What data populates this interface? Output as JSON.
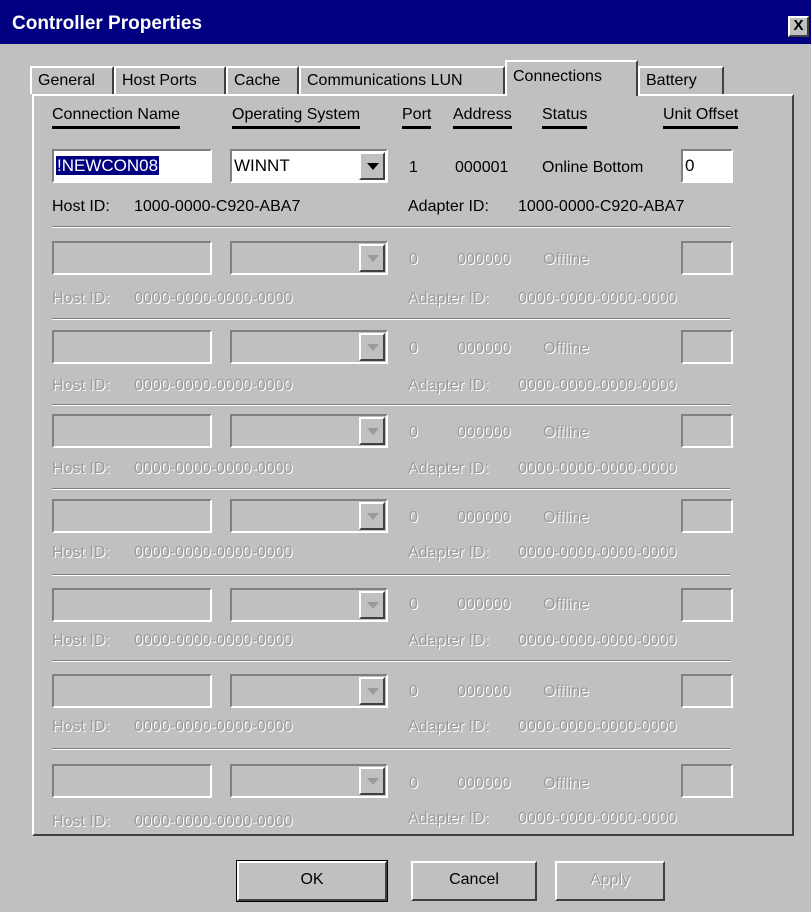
{
  "window": {
    "title": "Controller Properties",
    "close_label": "X"
  },
  "tabs": [
    {
      "label": "General"
    },
    {
      "label": "Host Ports"
    },
    {
      "label": "Cache"
    },
    {
      "label": "Communications LUN"
    },
    {
      "label": "Connections"
    },
    {
      "label": "Battery"
    }
  ],
  "active_tab": "Connections",
  "columns": {
    "name": "Connection Name",
    "os": "Operating System",
    "port": "Port",
    "address": "Address",
    "status": "Status",
    "offset": "Unit Offset"
  },
  "rows": [
    {
      "name": "!NEWCON08",
      "os": "WINNT",
      "port": "1",
      "address": "000001",
      "status": "Online Bottom",
      "offset": "0",
      "host_label": "Host ID:",
      "host_id": "1000-0000-C920-ABA7",
      "adapter_label": "Adapter ID:",
      "adapter_id": "1000-0000-C920-ABA7"
    },
    {
      "name": "",
      "os": "",
      "port": "0",
      "address": "000000",
      "status": "Offline",
      "offset": "",
      "host_label": "Host ID:",
      "host_id": "0000-0000-0000-0000",
      "adapter_label": "Adapter ID:",
      "adapter_id": "0000-0000-0000-0000"
    },
    {
      "name": "",
      "os": "",
      "port": "0",
      "address": "000000",
      "status": "Offline",
      "offset": "",
      "host_label": "Host ID:",
      "host_id": "0000-0000-0000-0000",
      "adapter_label": "Adapter ID:",
      "adapter_id": "0000-0000-0000-0000"
    },
    {
      "name": "",
      "os": "",
      "port": "0",
      "address": "000000",
      "status": "Offline",
      "offset": "",
      "host_label": "Host ID:",
      "host_id": "0000-0000-0000-0000",
      "adapter_label": "Adapter ID:",
      "adapter_id": "0000-0000-0000-0000"
    },
    {
      "name": "",
      "os": "",
      "port": "0",
      "address": "000000",
      "status": "Offline",
      "offset": "",
      "host_label": "Host ID:",
      "host_id": "0000-0000-0000-0000",
      "adapter_label": "Adapter ID:",
      "adapter_id": "0000-0000-0000-0000"
    },
    {
      "name": "",
      "os": "",
      "port": "0",
      "address": "000000",
      "status": "Offline",
      "offset": "",
      "host_label": "Host ID:",
      "host_id": "0000-0000-0000-0000",
      "adapter_label": "Adapter ID:",
      "adapter_id": "0000-0000-0000-0000"
    },
    {
      "name": "",
      "os": "",
      "port": "0",
      "address": "000000",
      "status": "Offline",
      "offset": "",
      "host_label": "Host ID:",
      "host_id": "0000-0000-0000-0000",
      "adapter_label": "Adapter ID:",
      "adapter_id": "0000-0000-0000-0000"
    },
    {
      "name": "",
      "os": "",
      "port": "0",
      "address": "000000",
      "status": "Offline",
      "offset": "",
      "host_label": "Host ID:",
      "host_id": "0000-0000-0000-0000",
      "adapter_label": "Adapter ID:",
      "adapter_id": "0000-0000-0000-0000"
    }
  ],
  "buttons": {
    "ok": "OK",
    "cancel": "Cancel",
    "apply": "Apply"
  },
  "colors": {
    "title_bar": "#000080",
    "face": "#c0c0c0",
    "disabled_text": "#9a9a9a"
  }
}
